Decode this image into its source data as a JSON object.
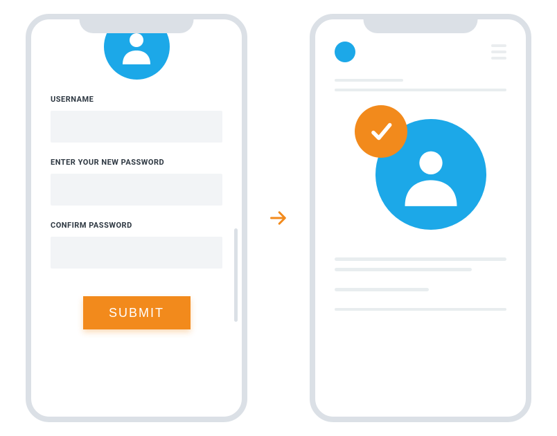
{
  "colors": {
    "accent": "#1ca8e8",
    "primary_action": "#f28a1c",
    "frame": "#dbe0e6",
    "text": "#2d3741",
    "placeholder": "#e8edef"
  },
  "left_phone": {
    "form": {
      "username_label": "USERNAME",
      "new_password_label": "ENTER YOUR NEW PASSWORD",
      "confirm_password_label": "CONFIRM PASSWORD",
      "submit_label": "SUBMIT"
    }
  },
  "right_phone": {
    "status": "success"
  }
}
